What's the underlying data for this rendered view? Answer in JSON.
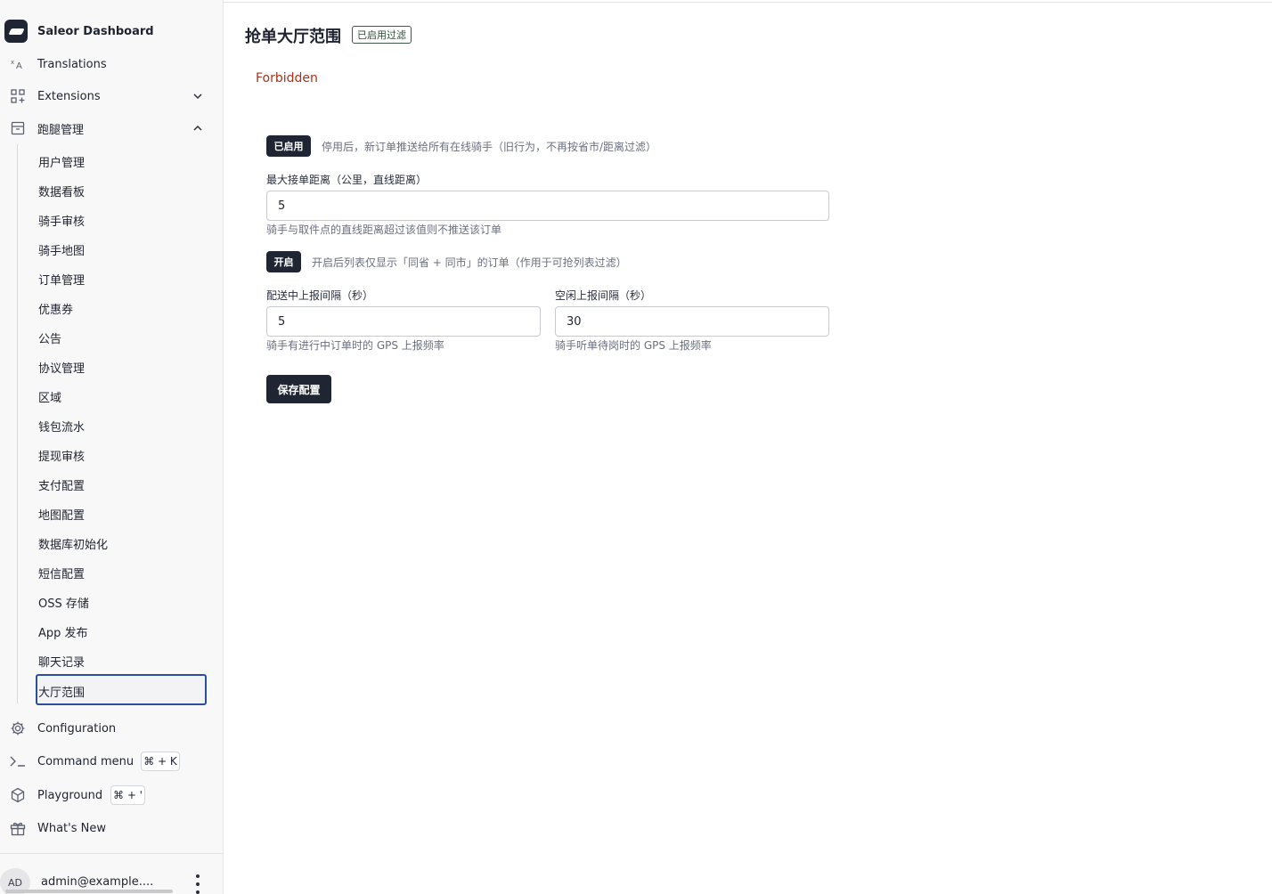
{
  "sidebar": {
    "brand": "Saleor Dashboard",
    "top_items": [
      {
        "label": "Translations",
        "icon": "translate-icon"
      },
      {
        "label": "Extensions",
        "icon": "grid-plus-icon"
      },
      {
        "label": "跑腿管理",
        "icon": "archive-icon"
      }
    ],
    "sub_items": [
      "用户管理",
      "数据看板",
      "骑手审核",
      "骑手地图",
      "订单管理",
      "优惠券",
      "公告",
      "协议管理",
      "区域",
      "钱包流水",
      "提现审核",
      "支付配置",
      "地图配置",
      "数据库初始化",
      "短信配置",
      "OSS 存储",
      "App 发布",
      "聊天记录"
    ],
    "active_item": "大厅范围",
    "bottom_items": [
      {
        "label": "Configuration",
        "icon": "gear-icon"
      },
      {
        "label": "Command menu",
        "icon": "terminal-icon",
        "shortcut": "⌘ + K"
      },
      {
        "label": "Playground",
        "icon": "cube-icon",
        "shortcut": "⌘ + '"
      },
      {
        "label": "What's New",
        "icon": "gift-icon"
      }
    ],
    "user": {
      "initials": "AD",
      "email": "admin@example...."
    }
  },
  "main": {
    "title": "抢单大厅范围",
    "title_badge": "已启用过滤",
    "error": "Forbidden",
    "filter_toggle": {
      "label": "已启用",
      "hint": "停用后，新订单推送给所有在线骑手（旧行为，不再按省市/距离过滤）"
    },
    "max_distance": {
      "label": "最大接单距离（公里，直线距离）",
      "value": "5",
      "help": "骑手与取件点的直线距离超过该值则不推送该订单"
    },
    "same_city_toggle": {
      "label": "开启",
      "hint": "开启后列表仅显示「同省 + 同市」的订单（作用于可抢列表过滤）"
    },
    "delivery_interval": {
      "label": "配送中上报间隔（秒）",
      "value": "5",
      "help": "骑手有进行中订单时的 GPS 上报频率"
    },
    "idle_interval": {
      "label": "空闲上报间隔（秒）",
      "value": "30",
      "help": "骑手听单待岗时的 GPS 上报频率"
    },
    "save_label": "保存配置"
  }
}
